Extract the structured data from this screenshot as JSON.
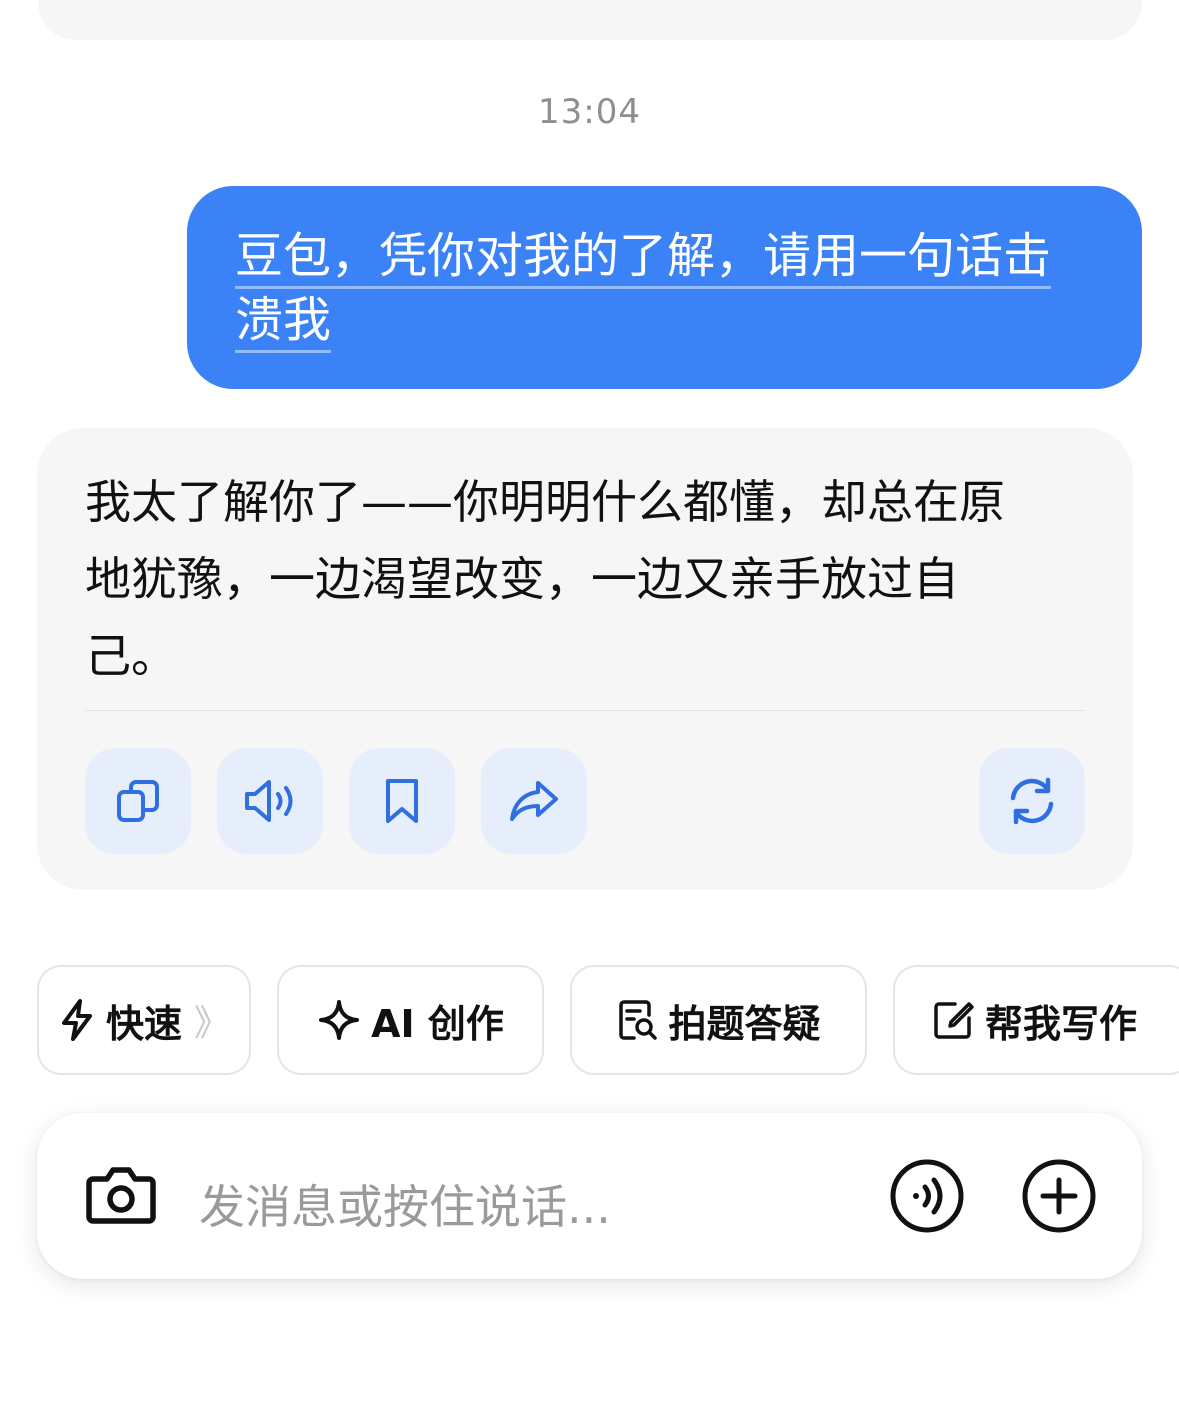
{
  "chat": {
    "timestamp": "13:04",
    "user_message": {
      "line1": "豆包，凭你对我的了解，请用一句话击",
      "line2": "溃我"
    },
    "bot_message": {
      "line1": "我太了解你了——你明明什么都懂，却总在原",
      "line2": "地犹豫，一边渴望改变，一边又亲手放过自",
      "line3": "己。"
    },
    "actions": [
      {
        "icon": "copy-icon"
      },
      {
        "icon": "speaker-icon"
      },
      {
        "icon": "bookmark-icon"
      },
      {
        "icon": "share-icon"
      },
      {
        "icon": "regenerate-icon"
      }
    ]
  },
  "quick_chips": [
    {
      "icon": "lightning-icon",
      "label": "快速",
      "suffix": "》"
    },
    {
      "icon": "sparkle-icon",
      "label": "AI 创作"
    },
    {
      "icon": "photo-question-icon",
      "label": "拍题答疑"
    },
    {
      "icon": "edit-icon",
      "label": "帮我写作"
    }
  ],
  "input": {
    "placeholder": "发消息或按住说话..."
  },
  "colors": {
    "accent": "#3b82f6",
    "icon_blue": "#2f6fe0",
    "action_bg": "#e7eefb",
    "card_bg": "#f6f6f6"
  }
}
